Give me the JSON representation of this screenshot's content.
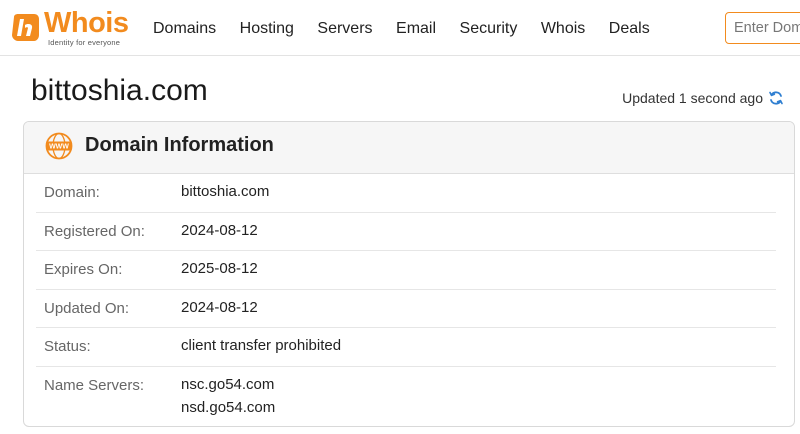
{
  "header": {
    "logo_text": "Whois",
    "logo_tagline": "Identity for everyone",
    "nav": [
      "Domains",
      "Hosting",
      "Servers",
      "Email",
      "Security",
      "Whois",
      "Deals"
    ],
    "search_placeholder": "Enter Domain"
  },
  "page": {
    "domain": "bittoshia.com",
    "updated_text": "Updated 1 second ago"
  },
  "card": {
    "title": "Domain Information",
    "rows": [
      {
        "label": "Domain:",
        "values": [
          "bittoshia.com"
        ]
      },
      {
        "label": "Registered On:",
        "values": [
          "2024-08-12"
        ]
      },
      {
        "label": "Expires On:",
        "values": [
          "2025-08-12"
        ]
      },
      {
        "label": "Updated On:",
        "values": [
          "2024-08-12"
        ]
      },
      {
        "label": "Status:",
        "values": [
          "client transfer prohibited"
        ]
      },
      {
        "label": "Name Servers:",
        "values": [
          "nsc.go54.com",
          "nsd.go54.com"
        ]
      }
    ]
  },
  "colors": {
    "brand": "#f28b1e",
    "refresh": "#2f7fd1"
  },
  "icons": {
    "logo": "whois-logo-icon",
    "refresh": "refresh-icon",
    "card": "www-globe-icon"
  }
}
